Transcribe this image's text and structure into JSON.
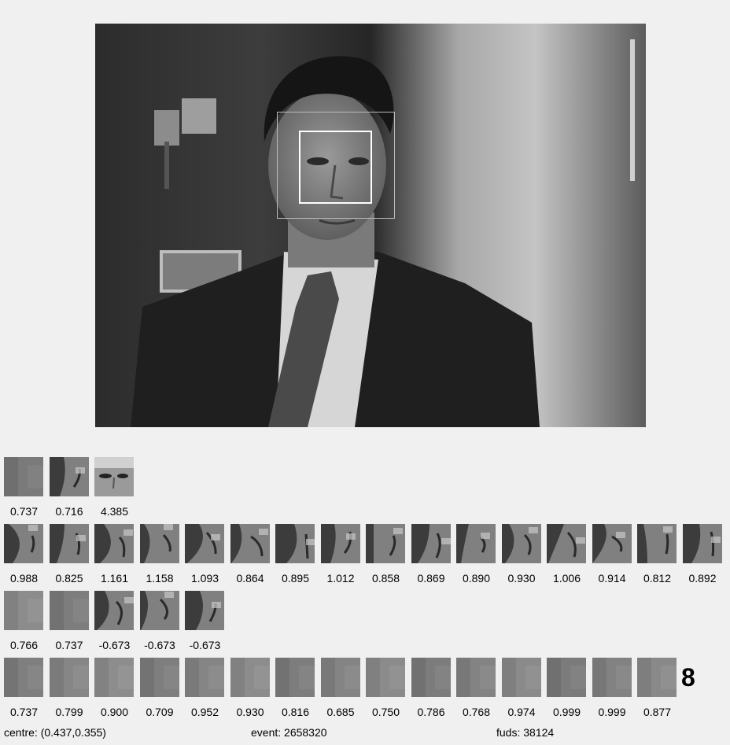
{
  "rows": [
    {
      "labels": [
        "0.737",
        "0.716",
        "4.385"
      ],
      "kinds": [
        "blur",
        "edge",
        "face"
      ]
    },
    {
      "labels": [
        "0.988",
        "0.825",
        "1.161",
        "1.158",
        "1.093",
        "0.864",
        "0.895",
        "1.012",
        "0.858",
        "0.869",
        "0.890",
        "0.930",
        "1.006",
        "0.914",
        "0.812",
        "0.892"
      ],
      "kinds": [
        "edge",
        "edge",
        "edge",
        "edge",
        "edge",
        "edge",
        "edge",
        "edge",
        "edge",
        "edge",
        "edge",
        "edge",
        "edge",
        "edge",
        "edge",
        "edge"
      ]
    },
    {
      "labels": [
        "0.766",
        "0.737",
        "-0.673",
        "-0.673",
        "-0.673"
      ],
      "kinds": [
        "blur",
        "blur",
        "edge",
        "edge",
        "edge"
      ]
    },
    {
      "labels": [
        "0.737",
        "0.799",
        "0.900",
        "0.709",
        "0.952",
        "0.930",
        "0.816",
        "0.685",
        "0.750",
        "0.786",
        "0.768",
        "0.974",
        "0.999",
        "0.999",
        "0.877"
      ],
      "kinds": [
        "blur",
        "blur",
        "blur",
        "blur",
        "blur",
        "blur",
        "blur",
        "blur",
        "blur",
        "blur",
        "blur",
        "blur",
        "blur",
        "blur",
        "blur"
      ]
    }
  ],
  "big_number": "8",
  "status": {
    "centre": "centre: (0.437,0.355)",
    "event": "event: 2658320",
    "fuds": "fuds: 38124"
  },
  "colors": {
    "tile_gray": "#808080",
    "tile_dark": "#2a2a2a",
    "tile_light": "#c8c8c8",
    "blur_base": "#8a8a8a"
  }
}
